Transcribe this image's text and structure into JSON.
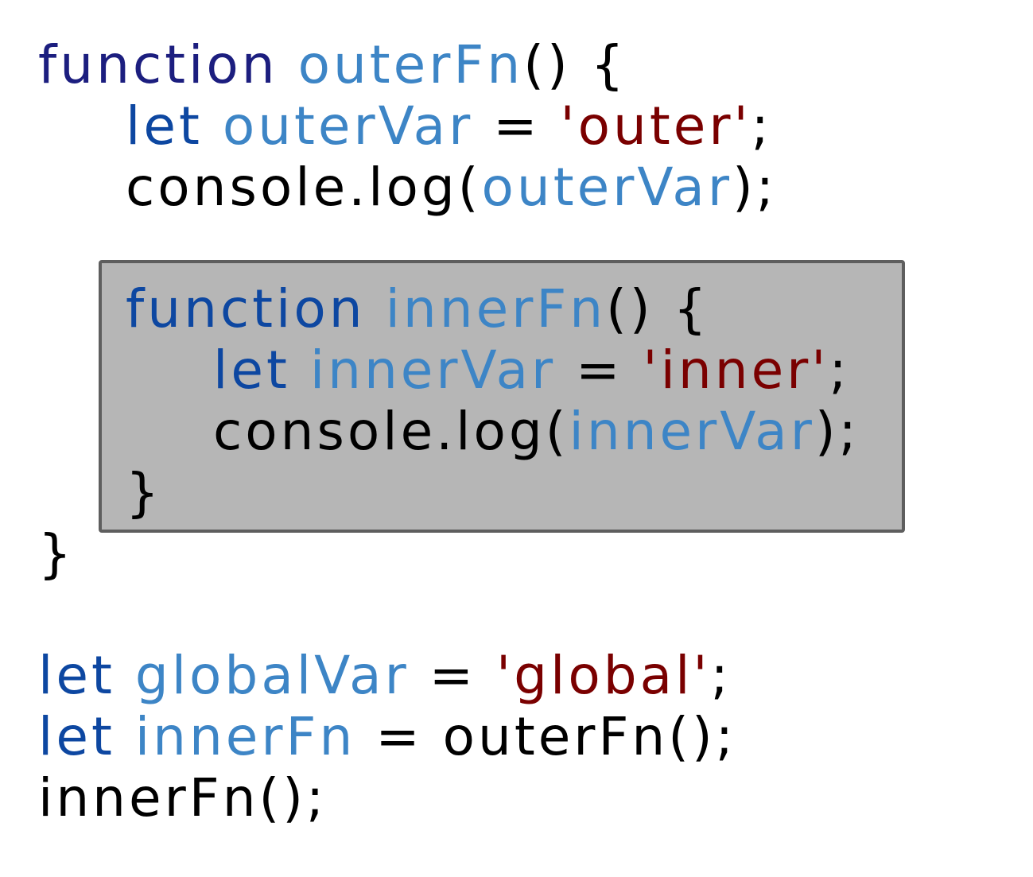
{
  "code": {
    "outer_fn_decl": {
      "keyword": "function",
      "name": "outerFn",
      "parens_brace": "() {"
    },
    "outer_let": {
      "keyword": "let",
      "name": "outerVar",
      "eq": " = ",
      "value": "'outer'",
      "semi": ";"
    },
    "outer_log": {
      "call": "console.log(",
      "arg": "outerVar",
      "close": ");"
    },
    "inner_fn_decl": {
      "keyword": "function",
      "name": "innerFn",
      "parens_brace": "() {"
    },
    "inner_let": {
      "keyword": "let",
      "name": "innerVar",
      "eq": " = ",
      "value": "'inner'",
      "semi": ";"
    },
    "inner_log": {
      "call": "console.log(",
      "arg": "innerVar",
      "close": ");"
    },
    "inner_close": "}",
    "outer_close": "}",
    "global_let": {
      "keyword": "let",
      "name": "globalVar",
      "eq": " = ",
      "value": "'global'",
      "semi": ";"
    },
    "inner_assign": {
      "keyword": "let",
      "name": "innerFn",
      "eq": " = ",
      "rhs": "outerFn();"
    },
    "call_line": "innerFn();"
  },
  "colors": {
    "keyword_function": "#1c1e7f",
    "keyword_let": "#0d47a1",
    "identifier": "#3d85c6",
    "string": "#7a0000",
    "plain": "#000000",
    "highlight_box_fill": "#b6b6b6",
    "highlight_box_border": "#5e5e5e"
  }
}
